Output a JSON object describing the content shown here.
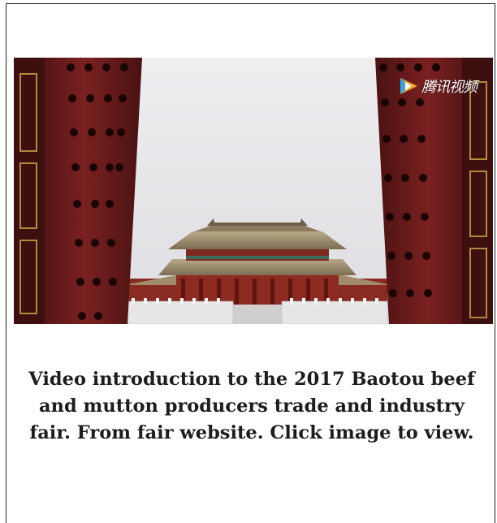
{
  "video": {
    "brand_text": "腾讯视频",
    "brand_icon": "play-logo-icon",
    "colors": {
      "sky": "#e9e9ec",
      "door_red": "#6e1b1b",
      "roof": "#9b8a6c",
      "hall_wall": "#8d2a22"
    }
  },
  "caption": {
    "text": "Video introduction to the 2017 Baotou beef and mutton producers trade and industry fair. From fair website. Click image to view."
  }
}
